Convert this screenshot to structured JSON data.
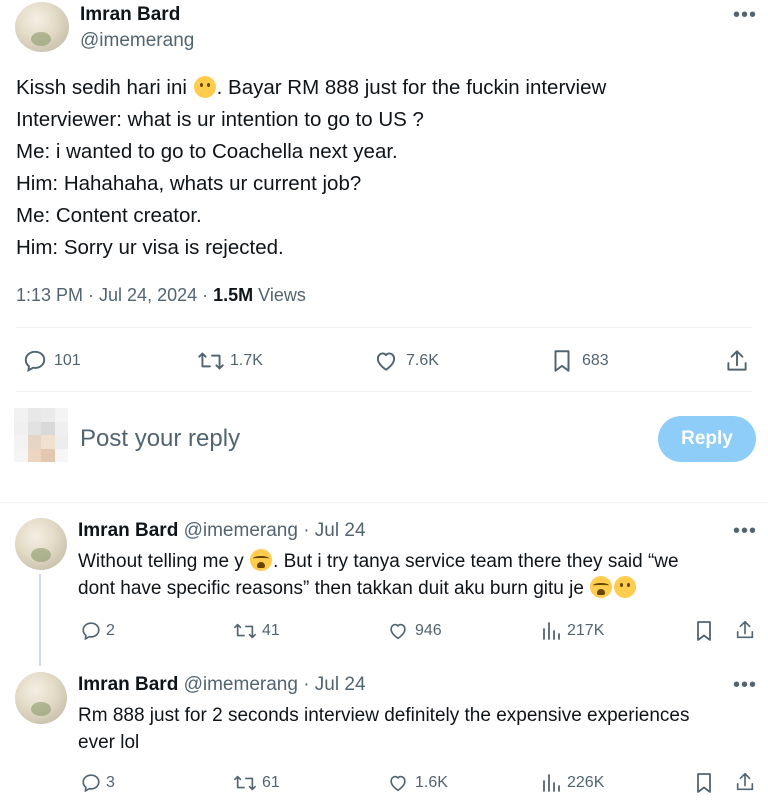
{
  "main_tweet": {
    "author_name": "Imran Bard",
    "author_handle": "@imemerang",
    "lines": [
      "Kissh sedih hari ini",
      ". Bayar RM 888 just for the fuckin interview",
      "Interviewer: what is ur intention to go to US ?",
      "Me: i wanted to go to Coachella next year.",
      "Him: Hahahaha, whats ur current job?",
      "Me: Content creator.",
      "Him: Sorry ur visa is rejected."
    ],
    "time": "1:13 PM · Jul 24, 2024 · ",
    "views_count": "1.5M",
    "views_label": " Views",
    "replies": "101",
    "reposts": "1.7K",
    "likes": "7.6K",
    "bookmarks": "683"
  },
  "composer": {
    "placeholder": "Post your reply",
    "reply_button": "Reply"
  },
  "replies": [
    {
      "author_name": "Imran Bard",
      "author_handle": "@imemerang",
      "date": "· Jul 24",
      "text_part1": "Without telling me y",
      "text_part2": ". But i try tanya service team there they said “we",
      "text_line2": "dont have specific reasons” then takkan duit aku burn gitu je",
      "replies": "2",
      "reposts": "41",
      "likes": "946",
      "views": "217K"
    },
    {
      "author_name": "Imran Bard",
      "author_handle": "@imemerang",
      "date": "· Jul 24",
      "text_line1": "Rm 888 just for 2 seconds interview definitely the expensive experiences",
      "text_line2": "ever lol",
      "replies": "3",
      "reposts": "61",
      "likes": "1.6K",
      "views": "226K"
    }
  ],
  "icons": {
    "more": "more-icon",
    "reply": "reply-icon",
    "repost": "repost-icon",
    "like": "like-icon",
    "bookmark": "bookmark-icon",
    "share": "share-icon",
    "views": "views-icon"
  },
  "colors": {
    "accent": "#1d9bf0",
    "reply_button_disabled": "#8ecdf8",
    "secondary_text": "#536471"
  }
}
